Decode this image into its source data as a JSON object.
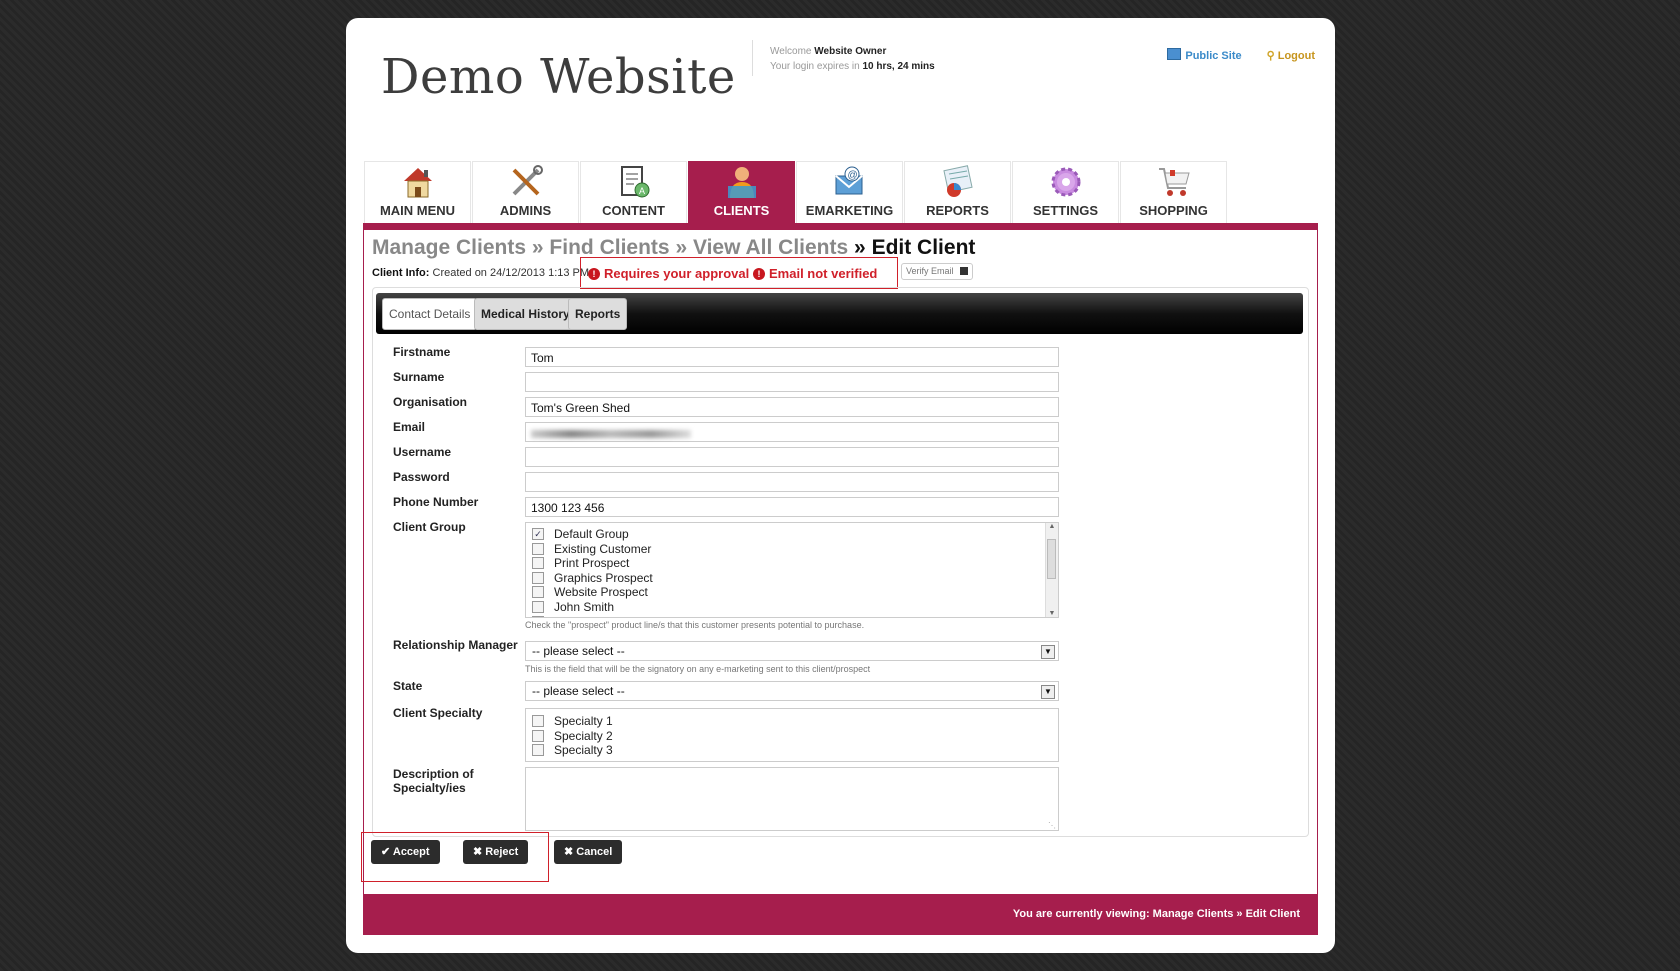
{
  "header": {
    "site_title": "Demo Website",
    "welcome_prefix": "Welcome",
    "welcome_user": "Website Owner",
    "expiry_prefix": "Your login expires in",
    "expiry_value": "10 hrs, 24 mins",
    "public_site": "Public Site",
    "logout": "Logout"
  },
  "nav": [
    {
      "label": "MAIN MENU",
      "icon": "house-icon",
      "active": false
    },
    {
      "label": "ADMINS",
      "icon": "tools-icon",
      "active": false
    },
    {
      "label": "CONTENT",
      "icon": "document-icon",
      "active": false
    },
    {
      "label": "CLIENTS",
      "icon": "person-icon",
      "active": true
    },
    {
      "label": "EMARKETING",
      "icon": "email-icon",
      "active": false
    },
    {
      "label": "REPORTS",
      "icon": "chart-icon",
      "active": false
    },
    {
      "label": "SETTINGS",
      "icon": "gear-icon",
      "active": false
    },
    {
      "label": "SHOPPING",
      "icon": "cart-icon",
      "active": false
    }
  ],
  "breadcrumb": {
    "crumb1": "Manage Clients",
    "crumb2": "Find Clients",
    "crumb3": "View All Clients",
    "current": "Edit Client",
    "sep": "»"
  },
  "client_info": {
    "label": "Client Info:",
    "created": "Created on 24/12/2013 1:13 PM",
    "warning_approval": "Requires your approval",
    "warning_email": "Email not verified",
    "verify_button": "Verify Email"
  },
  "tabs": [
    "Contact Details",
    "Medical History",
    "Reports"
  ],
  "form": {
    "firstname_label": "Firstname",
    "firstname_value": "Tom",
    "surname_label": "Surname",
    "surname_value": "",
    "organisation_label": "Organisation",
    "organisation_value": "Tom's Green Shed",
    "email_label": "Email",
    "username_label": "Username",
    "password_label": "Password",
    "phone_label": "Phone Number",
    "phone_value": "1300 123 456",
    "client_group_label": "Client Group",
    "client_groups": [
      {
        "label": "Default Group",
        "checked": true
      },
      {
        "label": "Existing Customer",
        "checked": false
      },
      {
        "label": "Print Prospect",
        "checked": false
      },
      {
        "label": "Graphics Prospect",
        "checked": false
      },
      {
        "label": "Website Prospect",
        "checked": false
      },
      {
        "label": "John Smith",
        "checked": false
      }
    ],
    "client_group_hint": "Check the \"prospect\" product line/s that this customer presents potential to purchase.",
    "relationship_label": "Relationship Manager",
    "relationship_value": "-- please select --",
    "relationship_hint": "This is the field that will be the signatory on any e-marketing sent to this client/prospect",
    "state_label": "State",
    "state_value": "-- please select --",
    "specialty_label": "Client Specialty",
    "specialties": [
      {
        "label": "Specialty 1",
        "checked": false
      },
      {
        "label": "Specialty 2",
        "checked": false
      },
      {
        "label": "Specialty 3",
        "checked": false
      }
    ],
    "description_label_1": "Description of",
    "description_label_2": "Specialty/ies"
  },
  "actions": {
    "accept": "Accept",
    "reject": "Reject",
    "cancel": "Cancel"
  },
  "footer": {
    "text": "You are currently viewing: Manage Clients » Edit Client"
  },
  "colors": {
    "brand": "#a61e4d",
    "warning": "#d0202a"
  }
}
